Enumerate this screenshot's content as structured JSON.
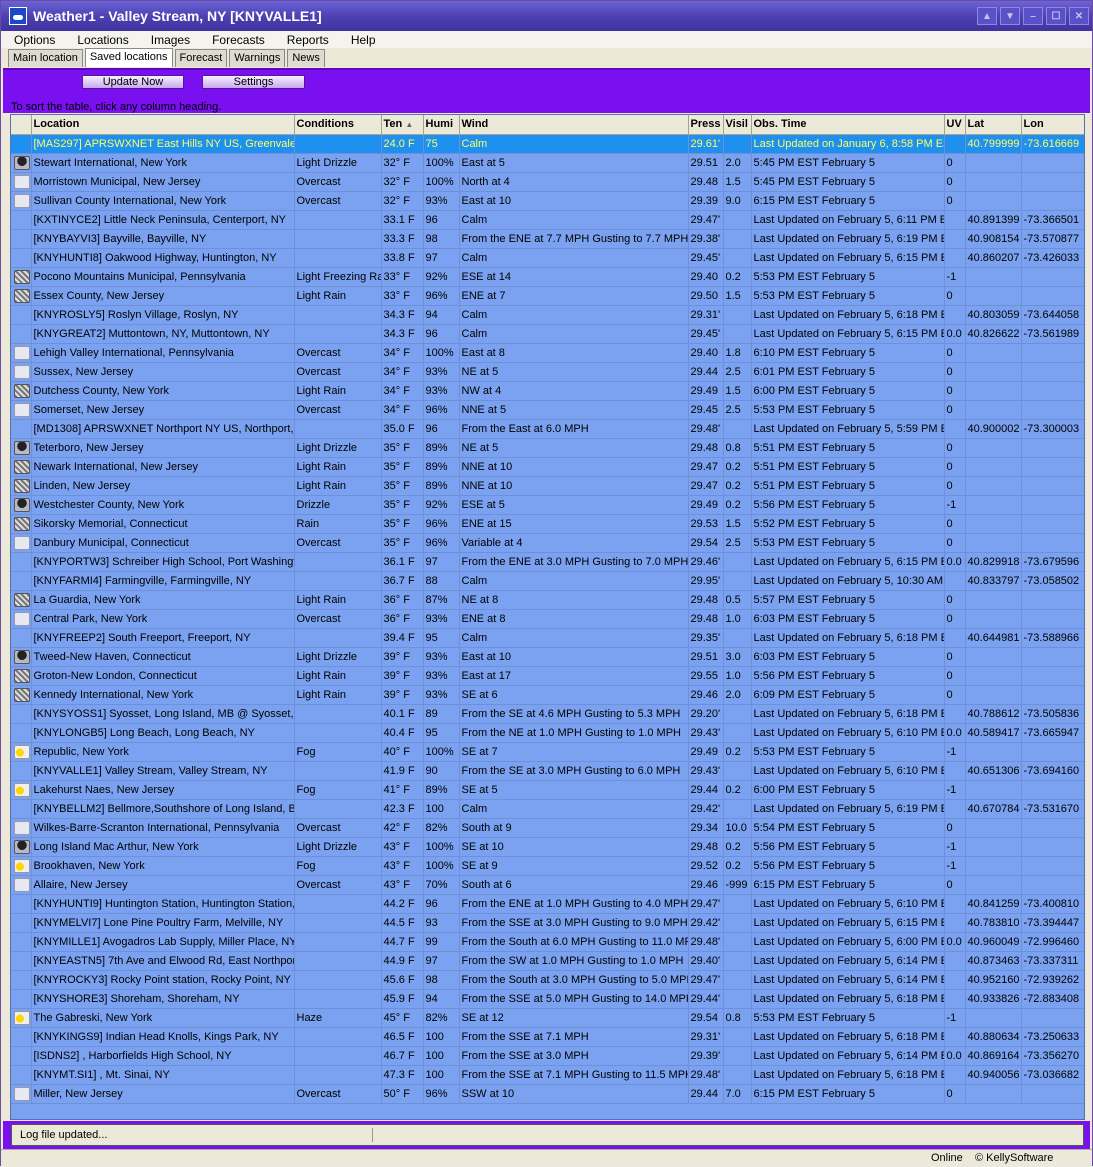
{
  "window": {
    "title": "Weather1 - Valley Stream, NY [KNYVALLE1]"
  },
  "menu": [
    "Options",
    "Locations",
    "Images",
    "Forecasts",
    "Reports",
    "Help"
  ],
  "tabs": [
    {
      "label": "Main location"
    },
    {
      "label": "Saved locations",
      "active": true
    },
    {
      "label": "Forecast"
    },
    {
      "label": "Warnings"
    },
    {
      "label": "News"
    }
  ],
  "toolbar": {
    "update_label": "Update Now",
    "settings_label": "Settings",
    "hint": "To sort the table, click any column heading."
  },
  "columns": [
    "Location",
    "Conditions",
    "Ten",
    "Humi",
    "Wind",
    "Press",
    "Visil",
    "Obs. Time",
    "UV",
    "Lat",
    "Lon"
  ],
  "rows": [
    [
      "",
      "[MAS297] APRSWXNET East Hills NY US, Greenvale, N",
      "",
      "24.0 F",
      "75",
      "Calm",
      "29.61'",
      "",
      "Last Updated on January 6, 8:58 PM ES",
      "",
      "40.799999",
      "-73.616669"
    ],
    [
      "drizzle",
      "Stewart International, New York",
      "Light Drizzle",
      "32° F",
      "100%",
      "East at 5",
      "29.51",
      "2.0",
      "5:45 PM EST February 5",
      "0",
      "",
      ""
    ],
    [
      "cloud",
      "Morristown Municipal, New Jersey",
      "Overcast",
      "32° F",
      "100%",
      "North at 4",
      "29.48",
      "1.5",
      "5:45 PM EST February 5",
      "0",
      "",
      ""
    ],
    [
      "cloud",
      "Sullivan County International, New York",
      "Overcast",
      "32° F",
      "93%",
      "East at 10",
      "29.39",
      "9.0",
      "6:15 PM EST February 5",
      "0",
      "",
      ""
    ],
    [
      "",
      "[KXTINYCE2] Little Neck Peninsula, Centerport, NY",
      "",
      "33.1 F",
      "96",
      "Calm",
      "29.47'",
      "",
      "Last Updated on February 5, 6:11 PM E",
      "",
      "40.891399",
      "-73.366501"
    ],
    [
      "",
      "[KNYBAYVI3] Bayville, Bayville, NY",
      "",
      "33.3 F",
      "98",
      "From the ENE at 7.7 MPH Gusting to 7.7 MPH",
      "29.38'",
      "",
      "Last Updated on February 5, 6:19 PM E",
      "",
      "40.908154",
      "-73.570877"
    ],
    [
      "",
      "[KNYHUNTI8] Oakwood Highway, Huntington, NY",
      "",
      "33.8 F",
      "97",
      "Calm",
      "29.45'",
      "",
      "Last Updated on February 5, 6:15 PM E",
      "",
      "40.860207",
      "-73.426033"
    ],
    [
      "rain",
      "Pocono Mountains Municipal, Pennsylvania",
      "Light Freezing Ra",
      "33° F",
      "92%",
      "ESE at 14",
      "29.40",
      "0.2",
      "5:53 PM EST February 5",
      "-1",
      "",
      ""
    ],
    [
      "rain",
      "Essex County, New Jersey",
      "Light Rain",
      "33° F",
      "96%",
      "ENE at 7",
      "29.50",
      "1.5",
      "5:53 PM EST February 5",
      "0",
      "",
      ""
    ],
    [
      "",
      "[KNYROSLY5] Roslyn Village, Roslyn, NY",
      "",
      "34.3 F",
      "94",
      "Calm",
      "29.31'",
      "",
      "Last Updated on February 5, 6:18 PM E",
      "",
      "40.803059",
      "-73.644058"
    ],
    [
      "",
      "[KNYGREAT2] Muttontown, NY, Muttontown, NY",
      "",
      "34.3 F",
      "96",
      "Calm",
      "29.45'",
      "",
      "Last Updated on February 5, 6:15 PM E",
      "0.0",
      "40.826622",
      "-73.561989"
    ],
    [
      "cloud",
      "Lehigh Valley International, Pennsylvania",
      "Overcast",
      "34° F",
      "100%",
      "East at 8",
      "29.40",
      "1.8",
      "6:10 PM EST February 5",
      "0",
      "",
      ""
    ],
    [
      "cloud",
      "Sussex, New Jersey",
      "Overcast",
      "34° F",
      "93%",
      "NE at 5",
      "29.44",
      "2.5",
      "6:01 PM EST February 5",
      "0",
      "",
      ""
    ],
    [
      "rain",
      "Dutchess County, New York",
      "Light Rain",
      "34° F",
      "93%",
      "NW at 4",
      "29.49",
      "1.5",
      "6:00 PM EST February 5",
      "0",
      "",
      ""
    ],
    [
      "cloud",
      "Somerset, New Jersey",
      "Overcast",
      "34° F",
      "96%",
      "NNE at 5",
      "29.45",
      "2.5",
      "5:53 PM EST February 5",
      "0",
      "",
      ""
    ],
    [
      "",
      "[MD1308] APRSWXNET Northport NY US, Northport, N",
      "",
      "35.0 F",
      "96",
      "From the East at 6.0 MPH",
      "29.48'",
      "",
      "Last Updated on February 5, 5:59 PM E",
      "",
      "40.900002",
      "-73.300003"
    ],
    [
      "drizzle",
      "Teterboro, New Jersey",
      "Light Drizzle",
      "35° F",
      "89%",
      "NE at 5",
      "29.48",
      "0.8",
      "5:51 PM EST February 5",
      "0",
      "",
      ""
    ],
    [
      "rain",
      "Newark International, New Jersey",
      "Light Rain",
      "35° F",
      "89%",
      "NNE at 10",
      "29.47",
      "0.2",
      "5:51 PM EST February 5",
      "0",
      "",
      ""
    ],
    [
      "rain",
      "Linden, New Jersey",
      "Light Rain",
      "35° F",
      "89%",
      "NNE at 10",
      "29.47",
      "0.2",
      "5:51 PM EST February 5",
      "0",
      "",
      ""
    ],
    [
      "drizzle",
      "Westchester County, New York",
      "Drizzle",
      "35° F",
      "92%",
      "ESE at 5",
      "29.49",
      "0.2",
      "5:56 PM EST February 5",
      "-1",
      "",
      ""
    ],
    [
      "rain",
      "Sikorsky Memorial, Connecticut",
      "Rain",
      "35° F",
      "96%",
      "ENE at 15",
      "29.53",
      "1.5",
      "5:52 PM EST February 5",
      "0",
      "",
      ""
    ],
    [
      "cloud",
      "Danbury Municipal, Connecticut",
      "Overcast",
      "35° F",
      "96%",
      "Variable at 4",
      "29.54",
      "2.5",
      "5:53 PM EST February 5",
      "0",
      "",
      ""
    ],
    [
      "",
      "[KNYPORTW3] Schreiber High School, Port Washingto",
      "",
      "36.1 F",
      "97",
      "From the ENE at 3.0 MPH Gusting to 7.0 MPH",
      "29.46'",
      "",
      "Last Updated on February 5, 6:15 PM E",
      "0.0",
      "40.829918",
      "-73.679596"
    ],
    [
      "",
      "[KNYFARMI4] Farmingville, Farmingville, NY",
      "",
      "36.7 F",
      "88",
      "Calm",
      "29.95'",
      "",
      "Last Updated on February 5, 10:30 AM",
      "",
      "40.833797",
      "-73.058502"
    ],
    [
      "rain",
      "La Guardia, New York",
      "Light Rain",
      "36° F",
      "87%",
      "NE at 8",
      "29.48",
      "0.5",
      "5:57 PM EST February 5",
      "0",
      "",
      ""
    ],
    [
      "cloud",
      "Central Park, New York",
      "Overcast",
      "36° F",
      "93%",
      "ENE at 8",
      "29.48",
      "1.0",
      "6:03 PM EST February 5",
      "0",
      "",
      ""
    ],
    [
      "",
      "[KNYFREEP2] South Freeport, Freeport, NY",
      "",
      "39.4 F",
      "95",
      "Calm",
      "29.35'",
      "",
      "Last Updated on February 5, 6:18 PM E",
      "",
      "40.644981",
      "-73.588966"
    ],
    [
      "drizzle",
      "Tweed-New Haven, Connecticut",
      "Light Drizzle",
      "39° F",
      "93%",
      "East at 10",
      "29.51",
      "3.0",
      "6:03 PM EST February 5",
      "0",
      "",
      ""
    ],
    [
      "rain",
      "Groton-New London, Connecticut",
      "Light Rain",
      "39° F",
      "93%",
      "East at 17",
      "29.55",
      "1.0",
      "5:56 PM EST February 5",
      "0",
      "",
      ""
    ],
    [
      "rain",
      "Kennedy International, New York",
      "Light Rain",
      "39° F",
      "93%",
      "SE at 6",
      "29.46",
      "2.0",
      "6:09 PM EST February 5",
      "0",
      "",
      ""
    ],
    [
      "",
      "[KNYSYOSS1] Syosset, Long Island, MB @ Syosset, N",
      "",
      "40.1 F",
      "89",
      "From the SE at 4.6 MPH Gusting to 5.3 MPH",
      "29.20'",
      "",
      "Last Updated on February 5, 6:18 PM E",
      "",
      "40.788612",
      "-73.505836"
    ],
    [
      "",
      "[KNYLONGB5] Long Beach, Long Beach, NY",
      "",
      "40.4 F",
      "95",
      "From the NE at 1.0 MPH Gusting to 1.0 MPH",
      "29.43'",
      "",
      "Last Updated on February 5, 6:10 PM E",
      "0.0",
      "40.589417",
      "-73.665947"
    ],
    [
      "fog",
      "Republic, New York",
      "Fog",
      "40° F",
      "100%",
      "SE at 7",
      "29.49",
      "0.2",
      "5:53 PM EST February 5",
      "-1",
      "",
      ""
    ],
    [
      "",
      "[KNYVALLE1] Valley Stream, Valley Stream, NY",
      "",
      "41.9 F",
      "90",
      "From the SE at 3.0 MPH Gusting to 6.0 MPH",
      "29.43'",
      "",
      "Last Updated on February 5, 6:10 PM E",
      "",
      "40.651306",
      "-73.694160"
    ],
    [
      "fog",
      "Lakehurst Naes, New Jersey",
      "Fog",
      "41° F",
      "89%",
      "SE at 5",
      "29.44",
      "0.2",
      "6:00 PM EST February 5",
      "-1",
      "",
      ""
    ],
    [
      "",
      "[KNYBELLM2] Bellmore,Southshore of Long Island, Bel",
      "",
      "42.3 F",
      "100",
      "Calm",
      "29.42'",
      "",
      "Last Updated on February 5, 6:19 PM E",
      "",
      "40.670784",
      "-73.531670"
    ],
    [
      "cloud",
      "Wilkes-Barre-Scranton International, Pennsylvania",
      "Overcast",
      "42° F",
      "82%",
      "South at 9",
      "29.34",
      "10.0",
      "5:54 PM EST February 5",
      "0",
      "",
      ""
    ],
    [
      "drizzle",
      "Long Island Mac Arthur, New York",
      "Light Drizzle",
      "43° F",
      "100%",
      "SE at 10",
      "29.48",
      "0.2",
      "5:56 PM EST February 5",
      "-1",
      "",
      ""
    ],
    [
      "fog",
      "Brookhaven, New York",
      "Fog",
      "43° F",
      "100%",
      "SE at 9",
      "29.52",
      "0.2",
      "5:56 PM EST February 5",
      "-1",
      "",
      ""
    ],
    [
      "cloud",
      "Allaire, New Jersey",
      "Overcast",
      "43° F",
      "70%",
      "South at 6",
      "29.46",
      "-999",
      "6:15 PM EST February 5",
      "0",
      "",
      ""
    ],
    [
      "",
      "[KNYHUNTI9] Huntington Station, Huntington Station,",
      "",
      "44.2 F",
      "96",
      "From the ENE at 1.0 MPH Gusting to 4.0 MPH",
      "29.47'",
      "",
      "Last Updated on February 5, 6:10 PM E",
      "",
      "40.841259",
      "-73.400810"
    ],
    [
      "",
      "[KNYMELVI7] Lone Pine Poultry Farm, Melville, NY",
      "",
      "44.5 F",
      "93",
      "From the SSE at 3.0 MPH Gusting to 9.0 MPH",
      "29.42'",
      "",
      "Last Updated on February 5, 6:15 PM E",
      "",
      "40.783810",
      "-73.394447"
    ],
    [
      "",
      "[KNYMILLE1] Avogadros Lab Supply, Miller Place, NY",
      "",
      "44.7 F",
      "99",
      "From the South at 6.0 MPH Gusting to 11.0 MP",
      "29.48'",
      "",
      "Last Updated on February 5, 6:00 PM E",
      "0.0",
      "40.960049",
      "-72.996460"
    ],
    [
      "",
      "[KNYEASTN5] 7th Ave and Elwood Rd, East Northport",
      "",
      "44.9 F",
      "97",
      "From the SW at 1.0 MPH Gusting to 1.0 MPH",
      "29.40'",
      "",
      "Last Updated on February 5, 6:14 PM E",
      "",
      "40.873463",
      "-73.337311"
    ],
    [
      "",
      "[KNYROCKY3] Rocky Point station, Rocky Point, NY",
      "",
      "45.6 F",
      "98",
      "From the South at 3.0 MPH Gusting to 5.0 MPH",
      "29.47'",
      "",
      "Last Updated on February 5, 6:14 PM E",
      "",
      "40.952160",
      "-72.939262"
    ],
    [
      "",
      "[KNYSHORE3] Shoreham, Shoreham, NY",
      "",
      "45.9 F",
      "94",
      "From the SSE at 5.0 MPH Gusting to 14.0 MPH",
      "29.44'",
      "",
      "Last Updated on February 5, 6:18 PM E",
      "",
      "40.933826",
      "-72.883408"
    ],
    [
      "fog",
      "The Gabreski, New York",
      "Haze",
      "45° F",
      "82%",
      "SE at 12",
      "29.54",
      "0.8",
      "5:53 PM EST February 5",
      "-1",
      "",
      ""
    ],
    [
      "",
      "[KNYKINGS9] Indian Head Knolls, Kings Park, NY",
      "",
      "46.5 F",
      "100",
      "From the SSE at 7.1 MPH",
      "29.31'",
      "",
      "Last Updated on February 5, 6:18 PM E",
      "",
      "40.880634",
      "-73.250633"
    ],
    [
      "",
      "[ISDNS2] , Harborfields High School, NY",
      "",
      "46.7 F",
      "100",
      "From the SSE at 3.0 MPH",
      "29.39'",
      "",
      "Last Updated on February 5, 6:14 PM E",
      "0.0",
      "40.869164",
      "-73.356270"
    ],
    [
      "",
      "[KNYMT.SI1] , Mt. Sinai, NY",
      "",
      "47.3 F",
      "100",
      "From the SSE at 7.1 MPH Gusting to 11.5 MPH",
      "29.48'",
      "",
      "Last Updated on February 5, 6:18 PM E",
      "",
      "40.940056",
      "-73.036682"
    ],
    [
      "cloud",
      "Miller, New Jersey",
      "Overcast",
      "50° F",
      "96%",
      "SSW at 10",
      "29.44",
      "7.0",
      "6:15 PM EST February 5",
      "0",
      "",
      ""
    ]
  ],
  "log": "Log file updated...",
  "status": {
    "online": "Online",
    "copyright": "© KellySoftware"
  }
}
